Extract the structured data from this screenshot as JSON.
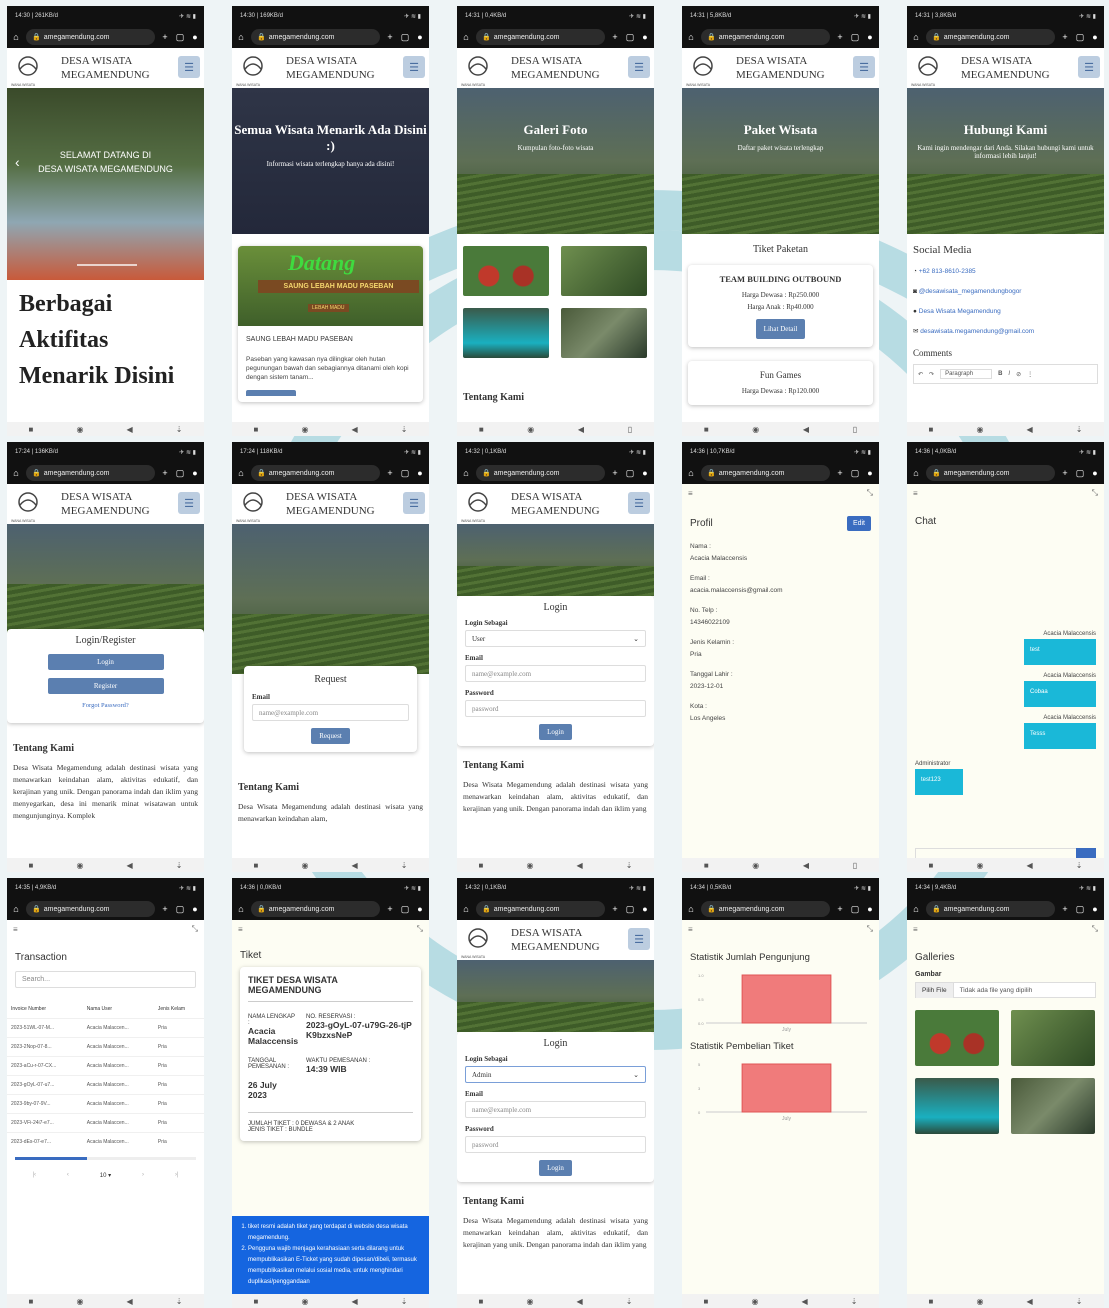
{
  "common": {
    "url": "amegamendung.com",
    "brand1": "DESA WISATA",
    "brand2": "MEGAMENDUNG",
    "logo_text": "WANA WISATA"
  },
  "status": [
    "14:30 | 261KB/d",
    "14:30 | 169KB/d",
    "14:31 | 0,4KB/d",
    "14:31 | 5,8KB/d",
    "14:31 | 3,8KB/d",
    "17:24 | 136KB/d",
    "17:24 | 118KB/d",
    "14:32 | 0,1KB/d",
    "14:36 | 10,7KB/d",
    "14:36 | 4,0KB/d",
    "14:35 | 4,9KB/d",
    "14:36 | 0,0KB/d",
    "14:32 | 0,1KB/d",
    "14:34 | 0,5KB/d",
    "14:34 | 9,4KB/d"
  ],
  "s1": {
    "hero1": "SELAMAT DATANG DI",
    "hero2": "DESA WISATA MEGAMENDUNG",
    "heading": "Berbagai Aktifitas Menarik Disini"
  },
  "s2": {
    "title": "Semua Wisata Menarik Ada Disini :)",
    "sub": "Informasi wisata terlengkap hanya ada disini!",
    "sign1": "Datang",
    "sign2": "SAUNG LEBAH MADU PASEBAN",
    "sign3": "LEBAH MADU",
    "card_title": "SAUNG LEBAH MADU PASEBAN",
    "card_text": "Paseban yang kawasan nya dilingkar oleh hutan pegunungan bawah dan sebagiannya ditanami oleh kopi dengan sistem tanam..."
  },
  "s3": {
    "title": "Galeri Foto",
    "sub": "Kumpulan foto-foto wisata",
    "about": "Tentang Kami"
  },
  "s4": {
    "title": "Paket Wisata",
    "sub": "Daftar paket wisata terlengkap",
    "section": "Tiket Paketan",
    "pkg": "TEAM BUILDING OUTBOUND",
    "adult": "Harga Dewasa : Rp250.000",
    "child": "Harga Anak : Rp40.000",
    "detail": "Lihat Detail",
    "pkg2": "Fun Games",
    "pkg2_price": "Harga Dewasa : Rp120.000"
  },
  "s5": {
    "title": "Hubungi Kami",
    "sub": "Kami ingin mendengar dari Anda. Silakan hubungi kami untuk informasi lebih lanjut!",
    "social": "Social Media",
    "phone": "+62 813-8610-2385",
    "ig": "@desawisata_megamendungbogor",
    "fb": "Desa Wisata Megamendung",
    "mail": "desawisata.megamendung@gmail.com",
    "comments": "Comments",
    "para": "Paragraph"
  },
  "s6": {
    "title": "Login/Register",
    "login": "Login",
    "register": "Register",
    "forgot": "Forgot Password?",
    "about": "Tentang Kami",
    "text": "Desa Wisata Megamendung adalah destinasi wisata yang menawarkan keindahan alam, aktivitas edukatif, dan kerajinan yang unik. Dengan panorama indah dan iklim yang menyegarkan, desa ini menarik minat wisatawan untuk mengunjunginya. Komplek"
  },
  "s7": {
    "title": "Request",
    "email": "Email",
    "ph": "name@example.com",
    "btn": "Request",
    "about": "Tentang Kami",
    "text": "Desa Wisata Megamendung adalah destinasi wisata yang menawarkan keindahan alam,"
  },
  "s8": {
    "title": "Login",
    "as": "Login Sebagai",
    "role": "User",
    "email": "Email",
    "eph": "name@example.com",
    "pw": "Password",
    "pph": "password",
    "btn": "Login",
    "about": "Tentang Kami",
    "text": "Desa Wisata Megamendung adalah destinasi wisata yang menawarkan keindahan alam, aktivitas edukatif, dan kerajinan yang unik. Dengan panorama indah dan iklim yang"
  },
  "s9": {
    "title": "Profil",
    "edit": "Edit",
    "rows": [
      [
        "Nama :",
        "Acacia Malaccensis"
      ],
      [
        "Email :",
        "acacia.malaccensis@gmail.com"
      ],
      [
        "No. Telp :",
        "14346022109"
      ],
      [
        "Jenis Kelamin :",
        "Pria"
      ],
      [
        "Tanggal Lahir :",
        "2023-12-01"
      ],
      [
        "Kota :",
        "Los Angeles"
      ]
    ]
  },
  "s10": {
    "title": "Chat",
    "msgs": [
      [
        "Acacia Malaccensis",
        "test"
      ],
      [
        "Acacia Malaccensis",
        "Cobaa"
      ],
      [
        "Acacia Malaccensis",
        "Tesss"
      ]
    ],
    "admin": "Administrator",
    "admin_msg": "test123"
  },
  "s11": {
    "title": "Transaction",
    "search": "Search...",
    "cols": [
      "Invoice Number",
      "Nama User",
      "Jenis Kelam"
    ],
    "rows": [
      [
        "2023-51WL-07-M...",
        "Acacia Malaccen...",
        "Pria"
      ],
      [
        "2023-2Nop-07-8...",
        "Acacia Malaccen...",
        "Pria"
      ],
      [
        "2023-aCu-r-07-CX...",
        "Acacia Malaccen...",
        "Pria"
      ],
      [
        "2023-gOyL-07-u7...",
        "Acacia Malaccen...",
        "Pria"
      ],
      [
        "2023-9by-07-9V...",
        "Acacia Malaccen...",
        "Pria"
      ],
      [
        "2023-VFi-24i7-e7...",
        "Acacia Malaccen...",
        "Pria"
      ],
      [
        "2023-dEs-07-e7...",
        "Acacia Malaccen...",
        "Pria"
      ]
    ],
    "perpage": "10"
  },
  "s12": {
    "title": "Tiket",
    "head": "TIKET DESA WISATA MEGAMENDUNG",
    "name_l": "NAMA LENGKAP :",
    "name_v": "Acacia Malaccensis",
    "res_l": "NO. RESERVASI :",
    "res_v": "2023-gOyL-07-u79G-26-tjPK9bzxsNeP",
    "date_l": "TANGGAL PEMESANAN :",
    "date_v": "26 July 2023",
    "time_l": "WAKTU PEMESANAN :",
    "time_v": "14:39 WIB",
    "count": "JUMLAH TIKET : 0 DEWASA & 2 ANAK",
    "type": "JENIS TIKET : BUNDLE",
    "notes": [
      "tiket resmi adalah tiket yang terdapat di website desa wisata megamendung.",
      "Pengguna wajib menjaga kerahasiaan serta dilarang untuk mempublikasikan E-Ticket yang sudah dipesan/dibeli, termasuk mempublikasikan melalui sosial media, untuk menghindari duplikasi/penggandaan"
    ]
  },
  "s13": {
    "title": "Login",
    "as": "Login Sebagai",
    "role": "Admin",
    "email": "Email",
    "eph": "name@example.com",
    "pw": "Password",
    "pph": "password",
    "btn": "Login",
    "about": "Tentang Kami",
    "text": "Desa Wisata Megamendung adalah destinasi wisata yang menawarkan keindahan alam, aktivitas edukatif, dan kerajinan yang unik. Dengan panorama indah dan iklim yang"
  },
  "s14": {
    "title1": "Statistik Jumlah Pengunjung",
    "title2": "Statistik Pembelian Tiket",
    "xlabel": "July"
  },
  "s15": {
    "title": "Galleries",
    "label": "Gambar",
    "file_btn": "Pilih File",
    "file_txt": "Tidak ada file yang dipilih"
  },
  "chart_data": [
    {
      "type": "bar",
      "title": "Statistik Jumlah Pengunjung",
      "categories": [
        "July"
      ],
      "values": [
        1
      ],
      "color": "#f07b7b"
    },
    {
      "type": "bar",
      "title": "Statistik Pembelian Tiket",
      "categories": [
        "July"
      ],
      "values": [
        5
      ],
      "color": "#f07b7b"
    }
  ]
}
